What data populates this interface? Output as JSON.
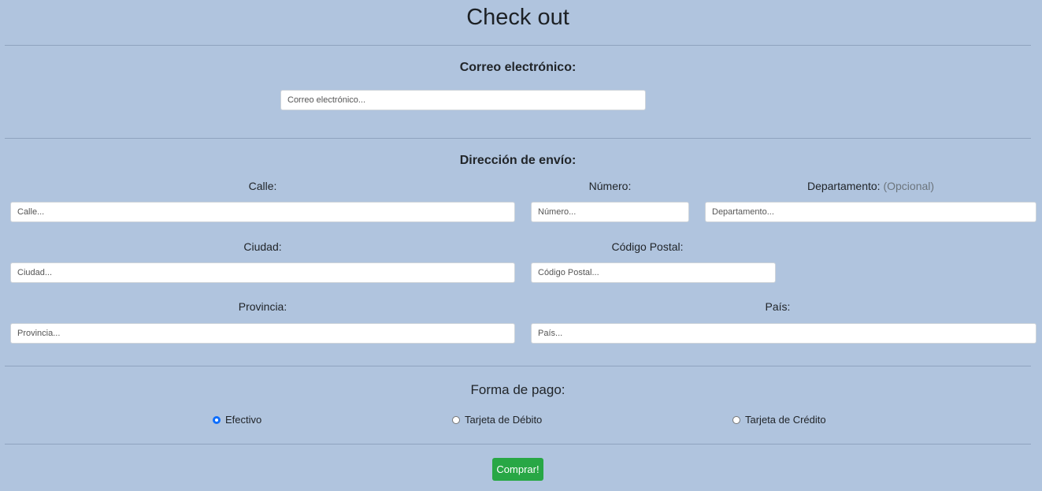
{
  "title": "Check out",
  "email": {
    "heading": "Correo electrónico:",
    "placeholder": "Correo electrónico..."
  },
  "shipping": {
    "heading": "Dirección de envío:",
    "street": {
      "label": "Calle:",
      "placeholder": "Calle..."
    },
    "number": {
      "label": "Número:",
      "placeholder": "Número..."
    },
    "apartment": {
      "label": "Departamento:",
      "optional": "(Opcional)",
      "placeholder": "Departamento..."
    },
    "city": {
      "label": "Ciudad:",
      "placeholder": "Ciudad..."
    },
    "postal": {
      "label": "Código Postal:",
      "placeholder": "Código Postal..."
    },
    "province": {
      "label": "Provincia:",
      "placeholder": "Provincia..."
    },
    "country": {
      "label": "País:",
      "placeholder": "País..."
    }
  },
  "payment": {
    "heading": "Forma de pago:",
    "options": [
      {
        "label": "Efectivo",
        "selected": true
      },
      {
        "label": "Tarjeta de Débito",
        "selected": false
      },
      {
        "label": "Tarjeta de Crédito",
        "selected": false
      }
    ]
  },
  "submit_label": "Comprar!",
  "colors": {
    "background": "#b0c4de",
    "accent": "#0d6efd",
    "button": "#28a745"
  }
}
